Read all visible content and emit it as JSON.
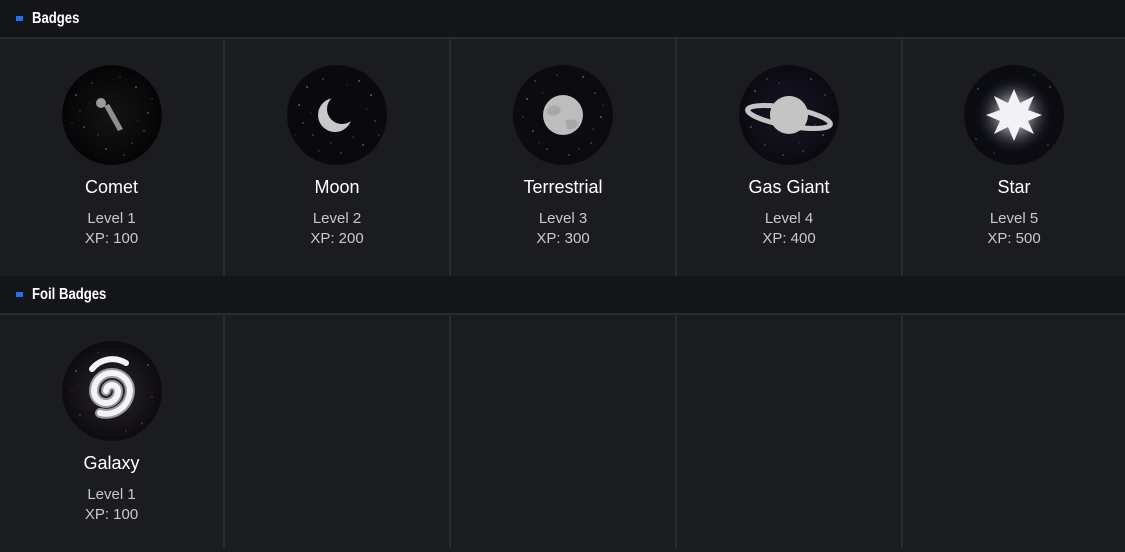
{
  "sections": {
    "badges": {
      "title": "Badges",
      "items": [
        {
          "name": "Comet",
          "level": "Level 1",
          "xp": "XP: 100",
          "icon": "comet-icon"
        },
        {
          "name": "Moon",
          "level": "Level 2",
          "xp": "XP: 200",
          "icon": "moon-icon"
        },
        {
          "name": "Terrestrial",
          "level": "Level 3",
          "xp": "XP: 300",
          "icon": "terrestrial-planet-icon"
        },
        {
          "name": "Gas Giant",
          "level": "Level 4",
          "xp": "XP: 400",
          "icon": "gas-giant-icon"
        },
        {
          "name": "Star",
          "level": "Level 5",
          "xp": "XP: 500",
          "icon": "star-icon"
        }
      ]
    },
    "foil_badges": {
      "title": "Foil Badges",
      "items": [
        {
          "name": "Galaxy",
          "level": "Level 1",
          "xp": "XP: 100",
          "icon": "galaxy-icon"
        }
      ]
    }
  },
  "colors": {
    "background": "#1b1c20",
    "header_background": "#141518",
    "divider": "#2a2b30",
    "accent": "#2e6fd0"
  }
}
